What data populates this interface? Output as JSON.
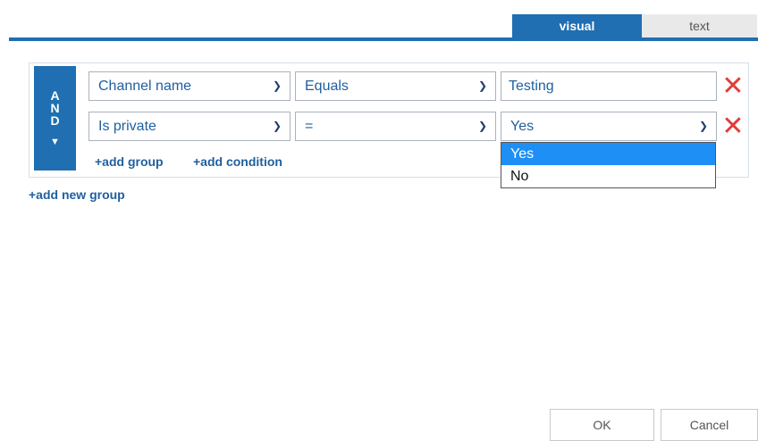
{
  "tabs": {
    "visual": "visual",
    "text": "text"
  },
  "group": {
    "operator_letters": [
      "A",
      "N",
      "D"
    ],
    "caret_icon": "caret-down-icon",
    "conditions": [
      {
        "field": "Channel name",
        "operator": "Equals",
        "value": "Testing"
      },
      {
        "field": "Is private",
        "operator": "=",
        "value": "Yes"
      }
    ],
    "add_group_label": "+add group",
    "add_condition_label": "+add condition"
  },
  "add_new_group_label": "+add new group",
  "value_dropdown": {
    "options": [
      "Yes",
      "No"
    ],
    "selected": "Yes"
  },
  "footer": {
    "ok_label": "OK",
    "cancel_label": "Cancel"
  },
  "colors": {
    "accent": "#1f6fb2",
    "remove": "#e43a3a",
    "option_highlight": "#1e8ff5"
  }
}
